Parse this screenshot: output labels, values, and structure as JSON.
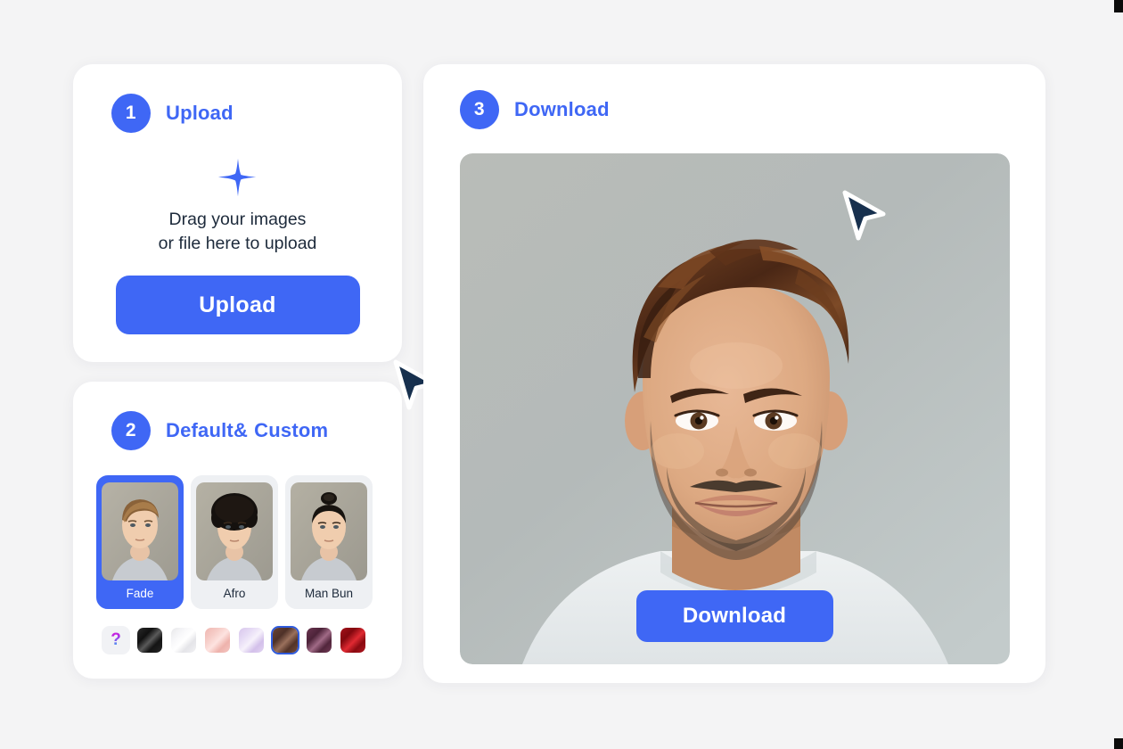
{
  "app": {
    "background_color": "#f4f4f5",
    "accent_color": "#3f67f5"
  },
  "upload_card": {
    "step_number": "1",
    "title": "Upload",
    "sparkle_icon": "sparkle-plus-icon",
    "drop_text_line1": "Drag your images",
    "drop_text_line2": "or file here to upload",
    "button_label": "Upload"
  },
  "styles_card": {
    "step_number": "2",
    "title_part1": "Default",
    "title_amp": "&",
    "title_part2": "Custom",
    "styles": [
      {
        "label": "Fade",
        "selected": true
      },
      {
        "label": "Afro",
        "selected": false
      },
      {
        "label": "Man Bun",
        "selected": false
      }
    ],
    "swatches": [
      {
        "name": "custom-help",
        "icon": "question-mark-icon",
        "label": "?",
        "color": "#f1f2f5",
        "selected": false
      },
      {
        "name": "black",
        "color": "#1c1c1c",
        "gradient_to": "#494949",
        "selected": false
      },
      {
        "name": "white-platinum",
        "color": "#ededf0",
        "gradient_to": "#ffffff",
        "selected": false
      },
      {
        "name": "rose-pink",
        "color": "#f0b3ae",
        "gradient_to": "#fbdedc",
        "selected": false
      },
      {
        "name": "lavender",
        "color": "#d6c4ec",
        "gradient_to": "#f2eafa",
        "selected": false
      },
      {
        "name": "brown",
        "color": "#5d3c32",
        "gradient_to": "#96705f",
        "selected": true
      },
      {
        "name": "plum",
        "color": "#5c2b43",
        "gradient_to": "#9d6079",
        "selected": false
      },
      {
        "name": "red",
        "color": "#9a1118",
        "gradient_to": "#d9232c",
        "selected": false
      }
    ]
  },
  "download_card": {
    "step_number": "3",
    "title": "Download",
    "preview_alt": "portrait-preview",
    "button_label": "Download"
  },
  "cursors": [
    {
      "name": "cursor-on-upload-button"
    },
    {
      "name": "cursor-on-download-button"
    }
  ]
}
